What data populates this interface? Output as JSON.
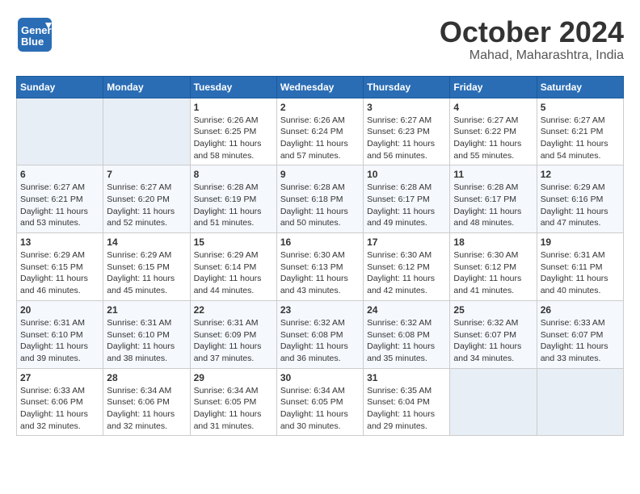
{
  "header": {
    "logo_general": "General",
    "logo_blue": "Blue",
    "month": "October 2024",
    "location": "Mahad, Maharashtra, India"
  },
  "calendar": {
    "headers": [
      "Sunday",
      "Monday",
      "Tuesday",
      "Wednesday",
      "Thursday",
      "Friday",
      "Saturday"
    ],
    "weeks": [
      [
        {
          "day": "",
          "sunrise": "",
          "sunset": "",
          "daylight": ""
        },
        {
          "day": "",
          "sunrise": "",
          "sunset": "",
          "daylight": ""
        },
        {
          "day": "1",
          "sunrise": "Sunrise: 6:26 AM",
          "sunset": "Sunset: 6:25 PM",
          "daylight": "Daylight: 11 hours and 58 minutes."
        },
        {
          "day": "2",
          "sunrise": "Sunrise: 6:26 AM",
          "sunset": "Sunset: 6:24 PM",
          "daylight": "Daylight: 11 hours and 57 minutes."
        },
        {
          "day": "3",
          "sunrise": "Sunrise: 6:27 AM",
          "sunset": "Sunset: 6:23 PM",
          "daylight": "Daylight: 11 hours and 56 minutes."
        },
        {
          "day": "4",
          "sunrise": "Sunrise: 6:27 AM",
          "sunset": "Sunset: 6:22 PM",
          "daylight": "Daylight: 11 hours and 55 minutes."
        },
        {
          "day": "5",
          "sunrise": "Sunrise: 6:27 AM",
          "sunset": "Sunset: 6:21 PM",
          "daylight": "Daylight: 11 hours and 54 minutes."
        }
      ],
      [
        {
          "day": "6",
          "sunrise": "Sunrise: 6:27 AM",
          "sunset": "Sunset: 6:21 PM",
          "daylight": "Daylight: 11 hours and 53 minutes."
        },
        {
          "day": "7",
          "sunrise": "Sunrise: 6:27 AM",
          "sunset": "Sunset: 6:20 PM",
          "daylight": "Daylight: 11 hours and 52 minutes."
        },
        {
          "day": "8",
          "sunrise": "Sunrise: 6:28 AM",
          "sunset": "Sunset: 6:19 PM",
          "daylight": "Daylight: 11 hours and 51 minutes."
        },
        {
          "day": "9",
          "sunrise": "Sunrise: 6:28 AM",
          "sunset": "Sunset: 6:18 PM",
          "daylight": "Daylight: 11 hours and 50 minutes."
        },
        {
          "day": "10",
          "sunrise": "Sunrise: 6:28 AM",
          "sunset": "Sunset: 6:17 PM",
          "daylight": "Daylight: 11 hours and 49 minutes."
        },
        {
          "day": "11",
          "sunrise": "Sunrise: 6:28 AM",
          "sunset": "Sunset: 6:17 PM",
          "daylight": "Daylight: 11 hours and 48 minutes."
        },
        {
          "day": "12",
          "sunrise": "Sunrise: 6:29 AM",
          "sunset": "Sunset: 6:16 PM",
          "daylight": "Daylight: 11 hours and 47 minutes."
        }
      ],
      [
        {
          "day": "13",
          "sunrise": "Sunrise: 6:29 AM",
          "sunset": "Sunset: 6:15 PM",
          "daylight": "Daylight: 11 hours and 46 minutes."
        },
        {
          "day": "14",
          "sunrise": "Sunrise: 6:29 AM",
          "sunset": "Sunset: 6:15 PM",
          "daylight": "Daylight: 11 hours and 45 minutes."
        },
        {
          "day": "15",
          "sunrise": "Sunrise: 6:29 AM",
          "sunset": "Sunset: 6:14 PM",
          "daylight": "Daylight: 11 hours and 44 minutes."
        },
        {
          "day": "16",
          "sunrise": "Sunrise: 6:30 AM",
          "sunset": "Sunset: 6:13 PM",
          "daylight": "Daylight: 11 hours and 43 minutes."
        },
        {
          "day": "17",
          "sunrise": "Sunrise: 6:30 AM",
          "sunset": "Sunset: 6:12 PM",
          "daylight": "Daylight: 11 hours and 42 minutes."
        },
        {
          "day": "18",
          "sunrise": "Sunrise: 6:30 AM",
          "sunset": "Sunset: 6:12 PM",
          "daylight": "Daylight: 11 hours and 41 minutes."
        },
        {
          "day": "19",
          "sunrise": "Sunrise: 6:31 AM",
          "sunset": "Sunset: 6:11 PM",
          "daylight": "Daylight: 11 hours and 40 minutes."
        }
      ],
      [
        {
          "day": "20",
          "sunrise": "Sunrise: 6:31 AM",
          "sunset": "Sunset: 6:10 PM",
          "daylight": "Daylight: 11 hours and 39 minutes."
        },
        {
          "day": "21",
          "sunrise": "Sunrise: 6:31 AM",
          "sunset": "Sunset: 6:10 PM",
          "daylight": "Daylight: 11 hours and 38 minutes."
        },
        {
          "day": "22",
          "sunrise": "Sunrise: 6:31 AM",
          "sunset": "Sunset: 6:09 PM",
          "daylight": "Daylight: 11 hours and 37 minutes."
        },
        {
          "day": "23",
          "sunrise": "Sunrise: 6:32 AM",
          "sunset": "Sunset: 6:08 PM",
          "daylight": "Daylight: 11 hours and 36 minutes."
        },
        {
          "day": "24",
          "sunrise": "Sunrise: 6:32 AM",
          "sunset": "Sunset: 6:08 PM",
          "daylight": "Daylight: 11 hours and 35 minutes."
        },
        {
          "day": "25",
          "sunrise": "Sunrise: 6:32 AM",
          "sunset": "Sunset: 6:07 PM",
          "daylight": "Daylight: 11 hours and 34 minutes."
        },
        {
          "day": "26",
          "sunrise": "Sunrise: 6:33 AM",
          "sunset": "Sunset: 6:07 PM",
          "daylight": "Daylight: 11 hours and 33 minutes."
        }
      ],
      [
        {
          "day": "27",
          "sunrise": "Sunrise: 6:33 AM",
          "sunset": "Sunset: 6:06 PM",
          "daylight": "Daylight: 11 hours and 32 minutes."
        },
        {
          "day": "28",
          "sunrise": "Sunrise: 6:34 AM",
          "sunset": "Sunset: 6:06 PM",
          "daylight": "Daylight: 11 hours and 32 minutes."
        },
        {
          "day": "29",
          "sunrise": "Sunrise: 6:34 AM",
          "sunset": "Sunset: 6:05 PM",
          "daylight": "Daylight: 11 hours and 31 minutes."
        },
        {
          "day": "30",
          "sunrise": "Sunrise: 6:34 AM",
          "sunset": "Sunset: 6:05 PM",
          "daylight": "Daylight: 11 hours and 30 minutes."
        },
        {
          "day": "31",
          "sunrise": "Sunrise: 6:35 AM",
          "sunset": "Sunset: 6:04 PM",
          "daylight": "Daylight: 11 hours and 29 minutes."
        },
        {
          "day": "",
          "sunrise": "",
          "sunset": "",
          "daylight": ""
        },
        {
          "day": "",
          "sunrise": "",
          "sunset": "",
          "daylight": ""
        }
      ]
    ]
  }
}
